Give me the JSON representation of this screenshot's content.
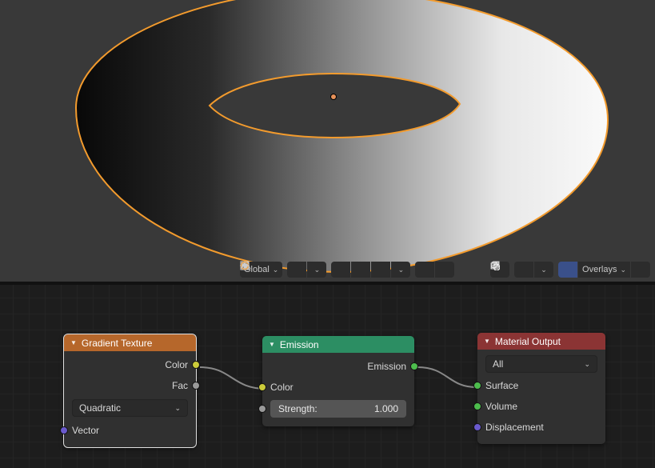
{
  "viewport": {
    "transform_orientation": "Global",
    "overlays_label": "Overlays"
  },
  "nodes": {
    "gradient": {
      "title": "Gradient Texture",
      "out_color": "Color",
      "out_fac": "Fac",
      "type_select": "Quadratic",
      "in_vector": "Vector"
    },
    "emission": {
      "title": "Emission",
      "out_emission": "Emission",
      "in_color": "Color",
      "strength_label": "Strength:",
      "strength_value": "1.000"
    },
    "output": {
      "title": "Material Output",
      "target_select": "All",
      "in_surface": "Surface",
      "in_volume": "Volume",
      "in_displacement": "Displacement"
    }
  }
}
